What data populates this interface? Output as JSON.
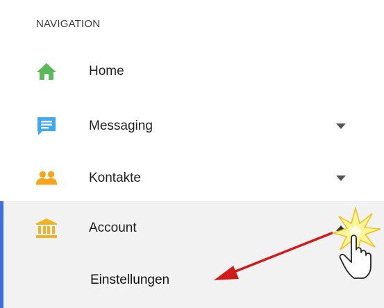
{
  "navigation": {
    "header": "NAVIGATION",
    "items": [
      {
        "label": "Home",
        "icon": "home-icon",
        "icon_color": "#5cb85c",
        "has_chevron": false
      },
      {
        "label": "Messaging",
        "icon": "chat-icon",
        "icon_color": "#3da9f5",
        "has_chevron": true,
        "chevron": "down"
      },
      {
        "label": "Kontakte",
        "icon": "people-icon",
        "icon_color": "#f7a51d",
        "has_chevron": true,
        "chevron": "down"
      },
      {
        "label": "Account",
        "icon": "bank-icon",
        "icon_color": "#f0b323",
        "has_chevron": true,
        "chevron": "up",
        "active": true
      }
    ],
    "submenu": {
      "items": [
        {
          "label": "Einstellungen"
        }
      ]
    }
  },
  "colors": {
    "active_bar": "#3f6fe0",
    "active_background": "#f2f2f2",
    "annotation_arrow": "#d11a1a",
    "chevron": "#555555"
  }
}
